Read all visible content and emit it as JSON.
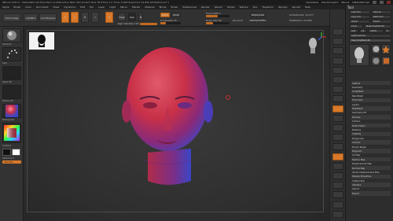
{
  "app": {
    "title": "ZBrush 2021.5 - DefaultZScript   Free Mem 11.0GB  Active Mem 493  Scratch Disk 78  ZTime 1.0  Timer 0.006  PolyCount 24,956 KP  MeshCount 1",
    "quicksave": "QuickSave",
    "see_through": "See-through 0",
    "menus": "Menus",
    "default_zscript": "DefaultZScript"
  },
  "menubar": [
    "Alpha",
    "Brush",
    "Color",
    "Document",
    "Draw",
    "Dynamics",
    "Edit",
    "File",
    "Layer",
    "Light",
    "Macro",
    "Marker",
    "Material",
    "Movie",
    "Picker",
    "Preferences",
    "Render",
    "Stencil",
    "Stroke",
    "Texture",
    "Tool",
    "Transform",
    "Zplugin",
    "Zscript",
    "Help"
  ],
  "toolbar": {
    "home_page": "Home Page",
    "lightbox": "LightBox",
    "live_boolean": "Live Boolean",
    "edit": "Edit",
    "draw": "Draw",
    "move": "Move",
    "scale": "Scale",
    "rotate": "Rotate",
    "mrgb": "Mrgb",
    "rgb": "Rgb",
    "m": "M",
    "zadd": "Zadd",
    "zsub": "Zsub",
    "rgb_intensity": "Rgb Intensity 100",
    "z_intensity": "Z Intensity 25",
    "focal_shift": "Focal Shift 0",
    "draw_size": "Draw Size 64",
    "dynamic": "Dynamic",
    "replay_last": "ReplayLast",
    "replay_last_rel": "ReplayLastRel",
    "active_points": "ActivePoints: 12,477",
    "total_points": "TotalPoints: 24,956"
  },
  "left_panel": {
    "brush_label": "Standard",
    "stroke_label": "Dots",
    "alpha_label": "Alpha Off",
    "texture_label": "Texture Off",
    "material_label": "MatCap Red",
    "gradient": "Gradient",
    "switch_color": "SwitchColor",
    "alternate": "Alternate"
  },
  "tray": {
    "title": "Tool",
    "load_tool": "Load Tool",
    "save_as": "Save As",
    "copy_tool": "Copy Tool",
    "paste_tool": "Paste Tool",
    "import": "Import",
    "export": "Export",
    "clone": "Clone",
    "make_polymesh": "Make PolyMesh3D",
    "goz": "GoZ",
    "all": "All",
    "visible": "Visible",
    "r": "R",
    "lightbox_tools": "Lightbox▸Tools",
    "current_tool": "Head_PolyMesh 48",
    "menu_items": [
      "Subtool",
      "Geometry",
      "ArrayMesh",
      "NanoMesh",
      "Thick Skin",
      "Layers",
      "FiberMesh",
      "Geometry HD",
      "Preview",
      "Surface",
      "Deformation",
      "Masking",
      "Visibility",
      "Polygroups",
      "Contact",
      "Morph Target",
      "Polypaint",
      "UV Map",
      "Texture Map",
      "Displacement Map",
      "Normal Map",
      "Vector Displacement Map",
      "Display Properties",
      "Unified Skin",
      "Initialize",
      "Import",
      "Export"
    ]
  },
  "right_strip": [
    "BPR",
    "SPix 3",
    "Scroll",
    "Zoom",
    "Actual",
    "AAHalf",
    "Persp",
    "Floor",
    "Local",
    "Gizmo",
    "Frame",
    "Move",
    "ZoomD",
    "Rotate",
    "Line Fill",
    "PolyF",
    "Transp",
    "Ghost",
    "Solo",
    "Xpose"
  ],
  "colors": {
    "accent": "#d8792a",
    "head_red": "#c83048",
    "head_blue": "#3a46c8"
  },
  "icons": [
    "brush-icon",
    "stroke-icon",
    "alpha-icon",
    "texture-icon",
    "material-icon",
    "color-picker-icon",
    "head-thumbnail-icon",
    "gizmo-axis-icon",
    "cursor-target-icon"
  ]
}
